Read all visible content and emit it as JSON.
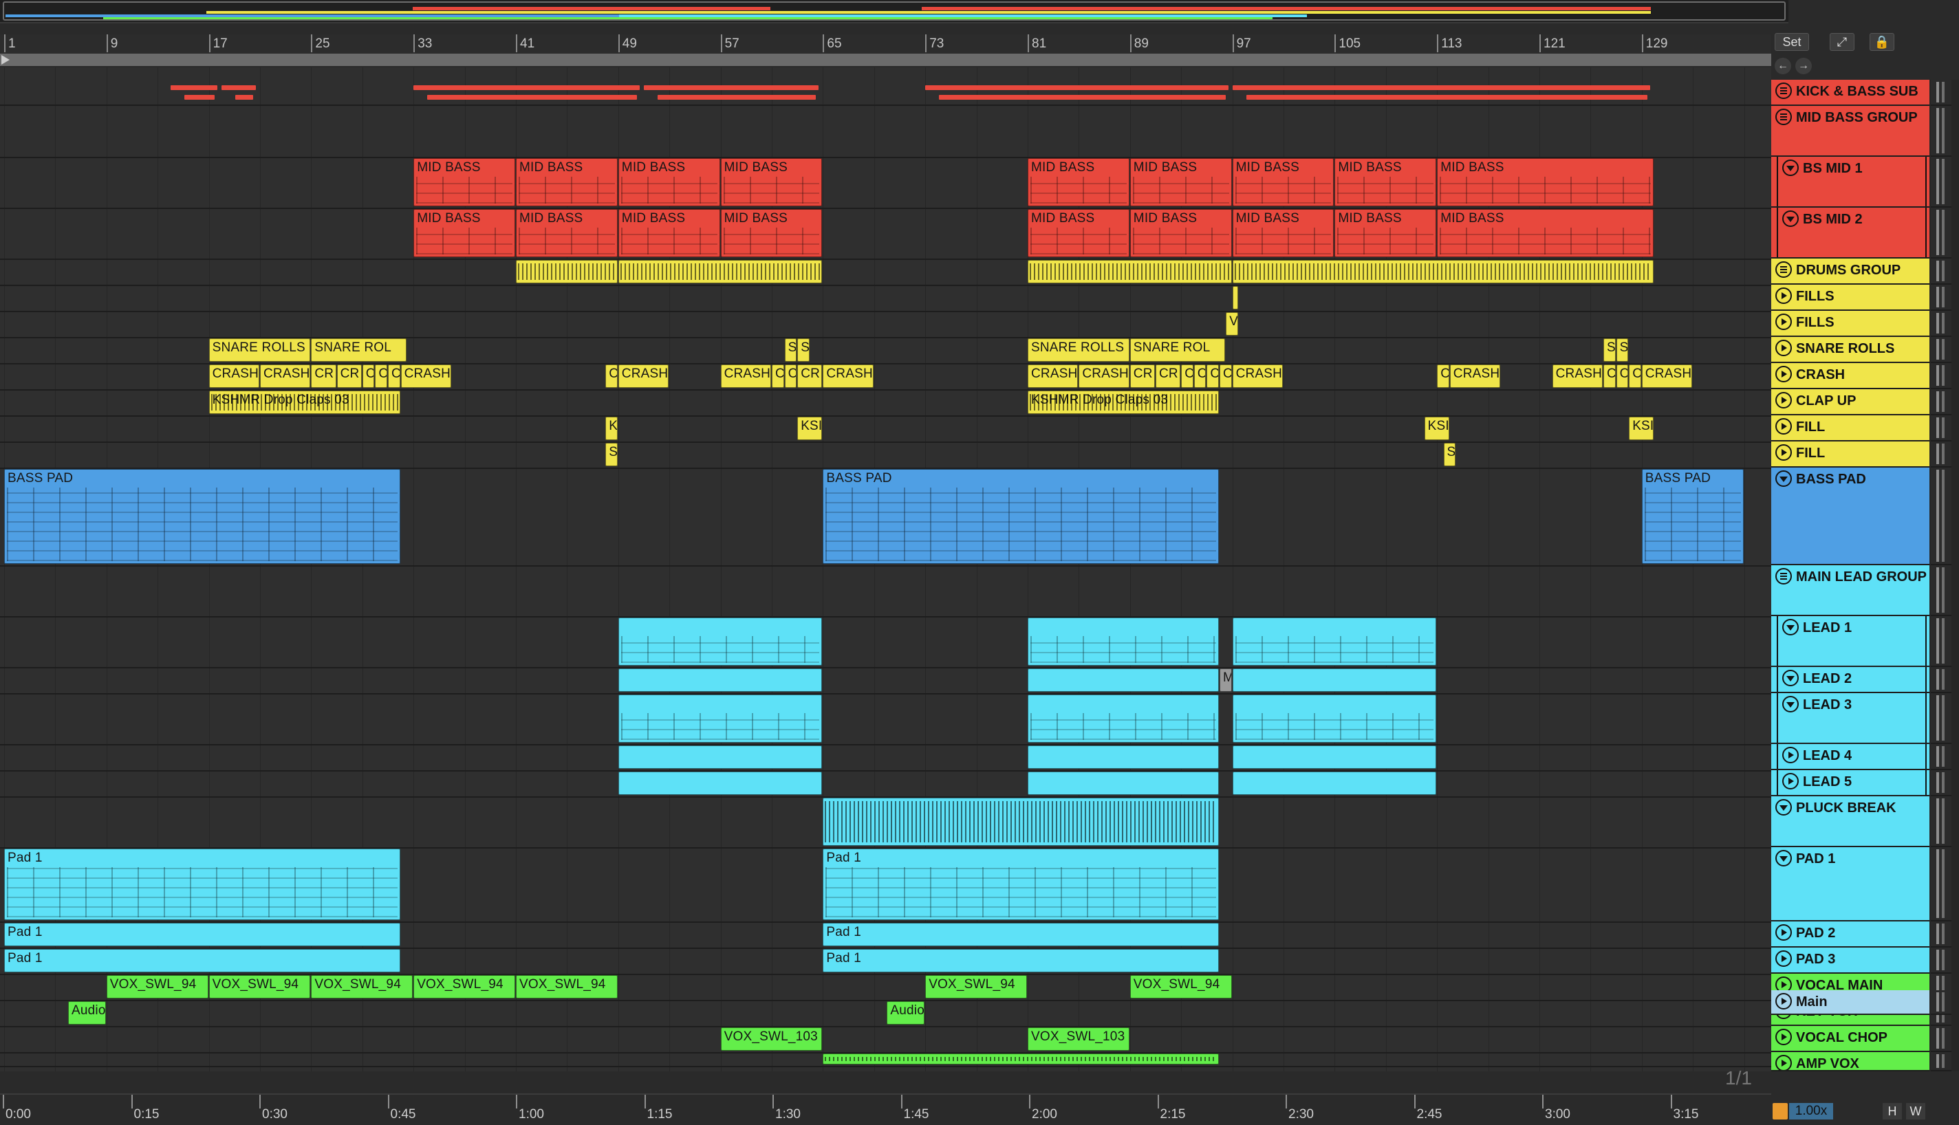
{
  "ruler_bars": [
    "1",
    "9",
    "17",
    "25",
    "33",
    "41",
    "49",
    "57",
    "65",
    "73",
    "81",
    "89",
    "97",
    "105",
    "113",
    "121",
    "129"
  ],
  "time_labels": [
    "0:00",
    "0:15",
    "0:30",
    "0:45",
    "1:00",
    "1:15",
    "1:30",
    "1:45",
    "2:00",
    "2:15",
    "2:30",
    "2:45",
    "3:00",
    "3:15"
  ],
  "top_controls": {
    "set_label": "Set",
    "expand_icon": "expand-icon",
    "lock_icon": "lock-icon"
  },
  "footer": {
    "page_indicator": "1/1",
    "zoom": "1.00x",
    "h_label": "H",
    "w_label": "W"
  },
  "colors": {
    "red": "#e8483d",
    "yellow": "#f0e54a",
    "blue": "#4f9fe4",
    "cyan": "#5ee1f7",
    "green": "#63ee4a",
    "main": "#a9d7ee"
  },
  "tracks": [
    {
      "name": "KICK & BASS SUB",
      "color": "#e8483d",
      "icon": "group"
    },
    {
      "name": "MID BASS GROUP",
      "color": "#e8483d",
      "icon": "group"
    },
    {
      "name": "BS MID 1",
      "color": "#e8483d",
      "icon": "fold"
    },
    {
      "name": "BS MID 2",
      "color": "#e8483d",
      "icon": "fold"
    },
    {
      "name": "DRUMS GROUP",
      "color": "#f0e54a",
      "icon": "group"
    },
    {
      "name": "FILLS",
      "color": "#f0e54a",
      "icon": "play"
    },
    {
      "name": "FILLS",
      "color": "#f0e54a",
      "icon": "play"
    },
    {
      "name": "SNARE ROLLS",
      "color": "#f0e54a",
      "icon": "play"
    },
    {
      "name": "CRASH",
      "color": "#f0e54a",
      "icon": "play"
    },
    {
      "name": "CLAP UP",
      "color": "#f0e54a",
      "icon": "play"
    },
    {
      "name": "FILL",
      "color": "#f0e54a",
      "icon": "play"
    },
    {
      "name": "FILL",
      "color": "#f0e54a",
      "icon": "play"
    },
    {
      "name": "BASS PAD",
      "color": "#4f9fe4",
      "icon": "fold"
    },
    {
      "name": "MAIN LEAD GROUP",
      "color": "#5ee1f7",
      "icon": "group"
    },
    {
      "name": "LEAD 1",
      "color": "#5ee1f7",
      "icon": "fold"
    },
    {
      "name": "LEAD 2",
      "color": "#5ee1f7",
      "icon": "fold"
    },
    {
      "name": "LEAD 3",
      "color": "#5ee1f7",
      "icon": "fold"
    },
    {
      "name": "LEAD 4",
      "color": "#5ee1f7",
      "icon": "play"
    },
    {
      "name": "LEAD 5",
      "color": "#5ee1f7",
      "icon": "play"
    },
    {
      "name": "PLUCK BREAK",
      "color": "#5ee1f7",
      "icon": "fold"
    },
    {
      "name": "PAD 1",
      "color": "#5ee1f7",
      "icon": "fold"
    },
    {
      "name": "PAD 2",
      "color": "#5ee1f7",
      "icon": "play"
    },
    {
      "name": "PAD 3",
      "color": "#5ee1f7",
      "icon": "play"
    },
    {
      "name": "VOCAL MAIN",
      "color": "#63ee4a",
      "icon": "play"
    },
    {
      "name": "REV VOX",
      "color": "#63ee4a",
      "icon": "play"
    },
    {
      "name": "VOCAL CHOP",
      "color": "#63ee4a",
      "icon": "play"
    },
    {
      "name": "AMP VOX",
      "color": "#63ee4a",
      "icon": "play"
    },
    {
      "name": "Main",
      "color": "#a9d7ee",
      "icon": "play"
    }
  ],
  "clips": {
    "mid_bass": "MID BASS",
    "snare_rolls": "SNARE ROLLS",
    "snare_rol": "SNARE ROL",
    "s": "S",
    "crash": "CRASH",
    "cr": "CR",
    "c": "C",
    "kshmr": "KSHMR Drop Claps 03",
    "ksi": "KSI",
    "k": "K",
    "v": "V",
    "bass_pad": "BASS PAD",
    "pad1": "Pad 1",
    "vox94": "VOX_SWL_94",
    "vox103": "VOX_SWL_103",
    "audio": "Audio",
    "m": "M"
  }
}
